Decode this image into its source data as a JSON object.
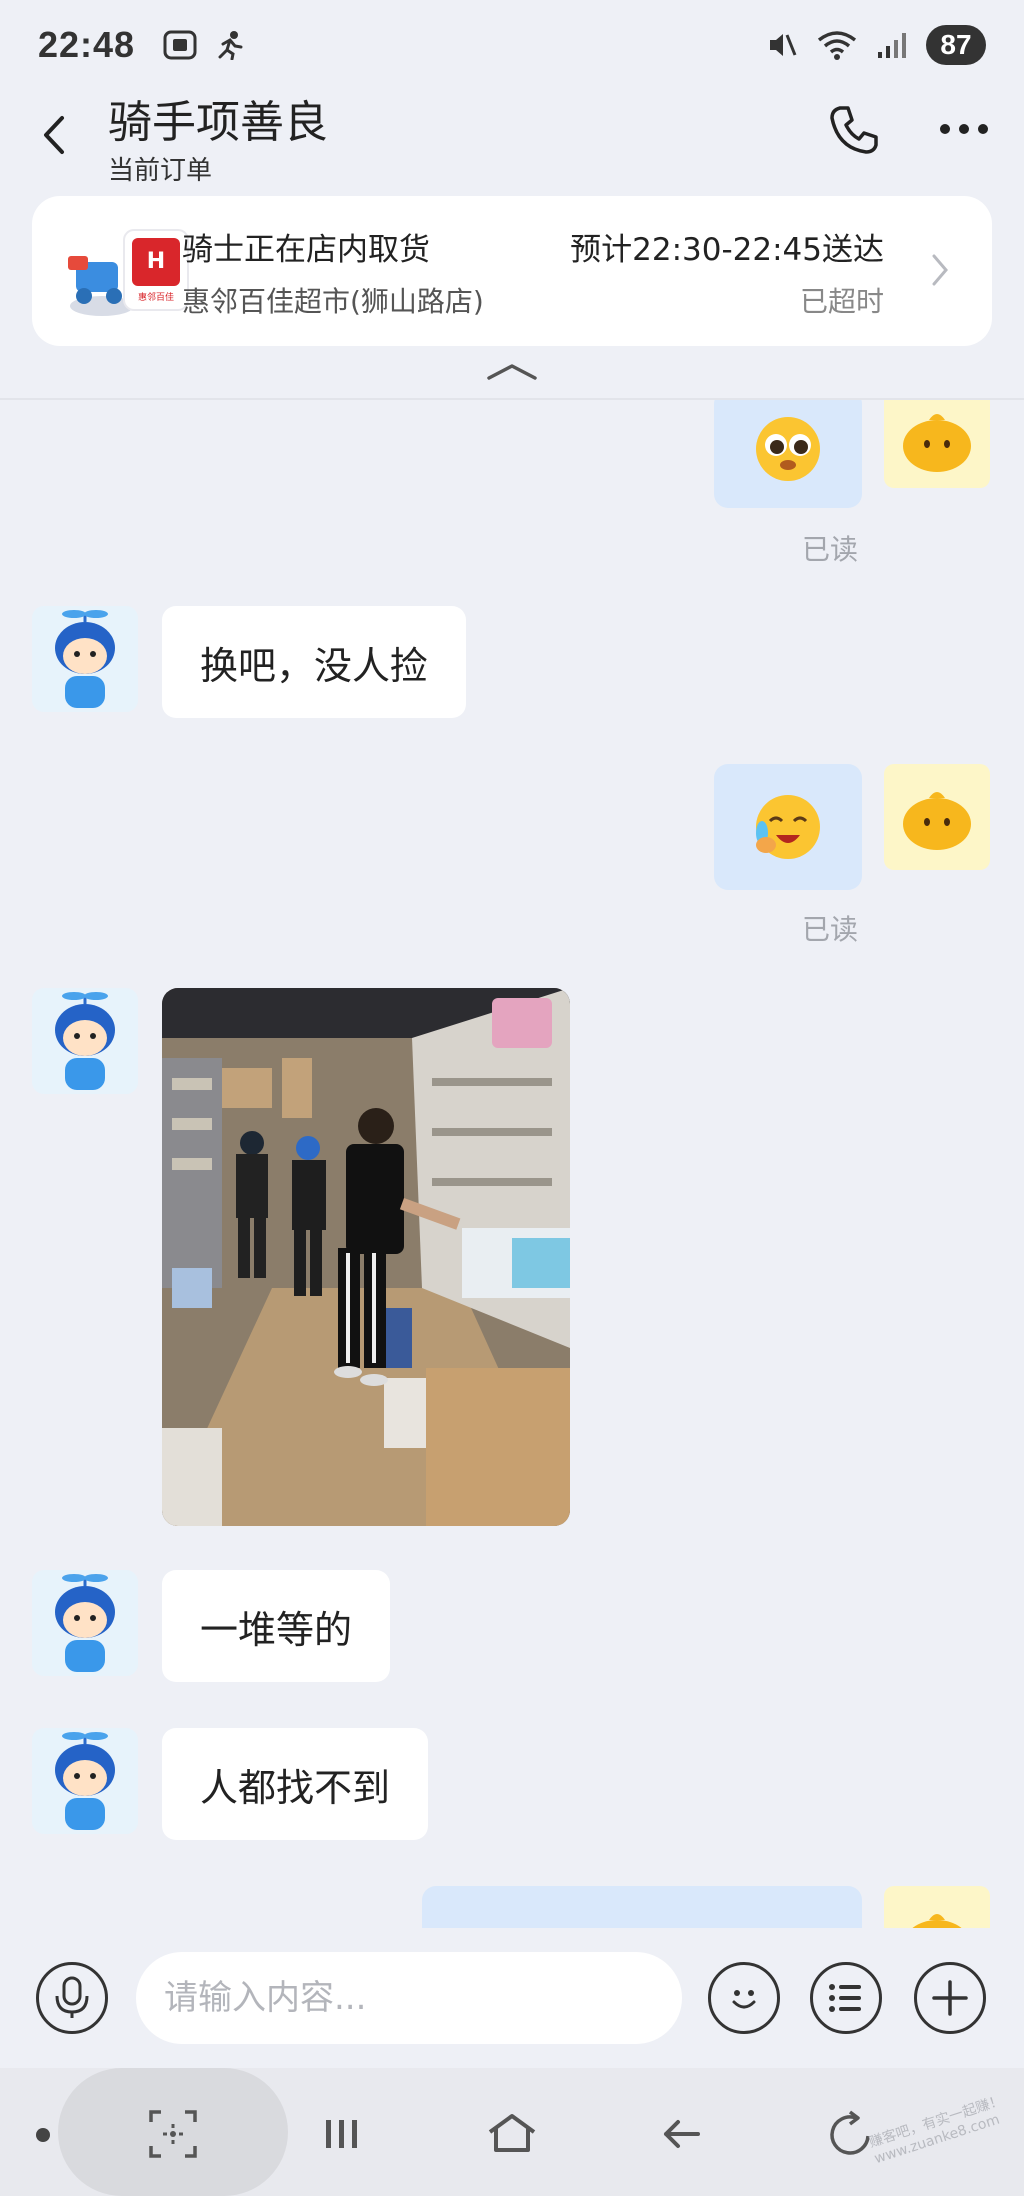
{
  "status_bar": {
    "time": "22:48",
    "battery": "87",
    "icons": [
      "screenshot-icon",
      "running-icon",
      "mute-icon",
      "wifi-icon",
      "signal-icon"
    ]
  },
  "header": {
    "title": "骑手项善良",
    "subtitle": "当前订单"
  },
  "order_card": {
    "status": "骑士正在店内取货",
    "eta": "预计22:30-22:45送达",
    "store": "惠邻百佳超市(狮山路店)",
    "overtime": "已超时",
    "logo_text": "惠邻百佳"
  },
  "messages": {
    "read_1": "已读",
    "msg_1": "换吧，没人捡",
    "read_2": "已读",
    "msg_2": "一堆等的",
    "msg_3": "人都找不到"
  },
  "input": {
    "placeholder": "请输入内容..."
  },
  "watermark": "赚客吧，有实一起赚！www.zuanke8.com",
  "colors": {
    "background": "#eef0f6",
    "outgoing_bubble": "#d9e8fb",
    "incoming_bubble": "#ffffff",
    "read_text": "#a3a6ad"
  }
}
